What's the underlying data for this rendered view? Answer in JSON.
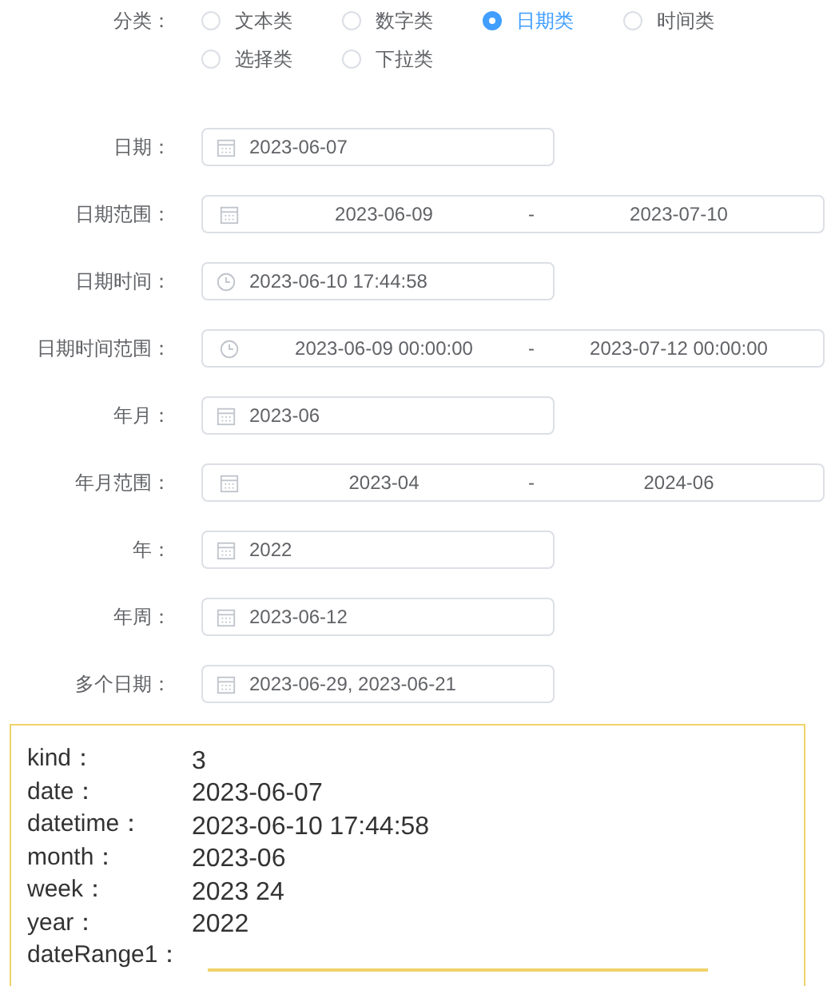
{
  "category": {
    "label": "分类：",
    "options": [
      {
        "label": "文本类",
        "selected": false
      },
      {
        "label": "数字类",
        "selected": false
      },
      {
        "label": "日期类",
        "selected": true
      },
      {
        "label": "时间类",
        "selected": false
      },
      {
        "label": "选择类",
        "selected": false
      },
      {
        "label": "下拉类",
        "selected": false
      }
    ]
  },
  "fields": [
    {
      "label": "日期：",
      "kind": "date",
      "value": "2023-06-07"
    },
    {
      "label": "日期范围：",
      "kind": "daterange",
      "start": "2023-06-09",
      "separator": "-",
      "end": "2023-07-10"
    },
    {
      "label": "日期时间：",
      "kind": "datetime",
      "value": "2023-06-10 17:44:58"
    },
    {
      "label": "日期时间范围：",
      "kind": "datetimerange",
      "start": "2023-06-09 00:00:00",
      "separator": "-",
      "end": "2023-07-12 00:00:00"
    },
    {
      "label": "年月：",
      "kind": "date",
      "value": "2023-06"
    },
    {
      "label": "年月范围：",
      "kind": "daterange",
      "start": "2023-04",
      "separator": "-",
      "end": "2024-06"
    },
    {
      "label": "年：",
      "kind": "date",
      "value": "2022"
    },
    {
      "label": "年周：",
      "kind": "date",
      "value": "2023-06-12"
    },
    {
      "label": "多个日期：",
      "kind": "date",
      "value": "2023-06-29, 2023-06-21"
    }
  ],
  "debug": {
    "rows": [
      {
        "key": "kind：",
        "value": "3"
      },
      {
        "key": "date：",
        "value": "2023-06-07"
      },
      {
        "key": "datetime：",
        "value": "2023-06-10 17:44:58"
      },
      {
        "key": "month：",
        "value": "2023-06"
      },
      {
        "key": "week：",
        "value": "2023 24"
      },
      {
        "key": "year：",
        "value": "2022"
      },
      {
        "key": "dateRange1：",
        "nested_box": true
      }
    ]
  }
}
